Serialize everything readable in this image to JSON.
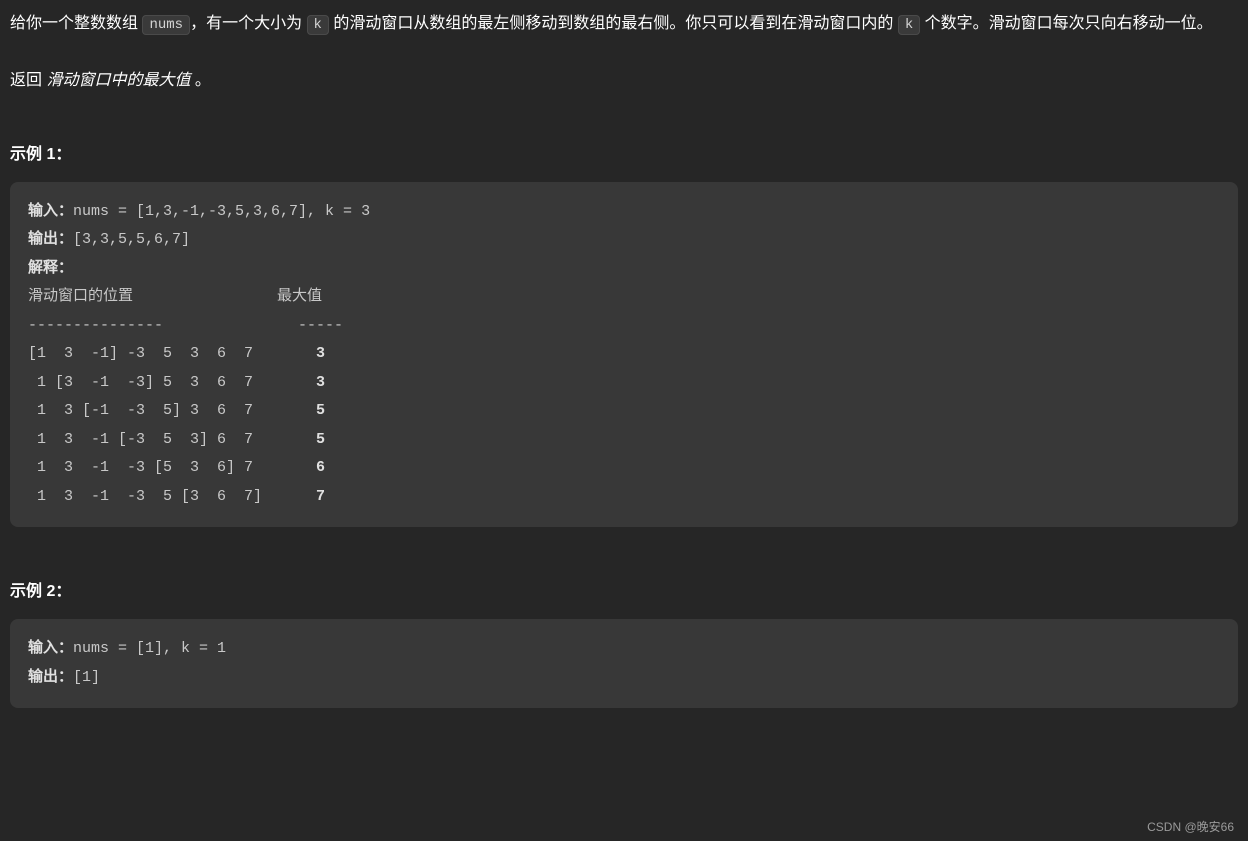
{
  "description": {
    "prefix1": "给你一个整数数组 ",
    "code1": "nums",
    "mid1": "，有一个大小为 ",
    "code2": "k",
    "mid2": " 的滑动窗口从数组的最左侧移动到数组的最右侧。你只可以看到在滑动窗口内的 ",
    "code3": "k",
    "suffix": " 个数字。滑动窗口每次只向右移动一位。"
  },
  "return_line": {
    "prefix": "返回 ",
    "italic": "滑动窗口中的最大值 ",
    "suffix": "。"
  },
  "example1": {
    "title": "示例 1：",
    "input_label": "输入：",
    "input_value": "nums = [1,3,-1,-3,5,3,6,7], k = 3",
    "output_label": "输出：",
    "output_value": "[3,3,5,5,6,7]",
    "explain_label": "解释：",
    "header_line": "滑动窗口的位置                最大值",
    "divider_line": "---------------               -----",
    "rows": [
      {
        "window": "[1  3  -1] -3  5  3  6  7       ",
        "max": "3"
      },
      {
        "window": " 1 [3  -1  -3] 5  3  6  7       ",
        "max": "3"
      },
      {
        "window": " 1  3 [-1  -3  5] 3  6  7       ",
        "max": "5"
      },
      {
        "window": " 1  3  -1 [-3  5  3] 6  7       ",
        "max": "5"
      },
      {
        "window": " 1  3  -1  -3 [5  3  6] 7       ",
        "max": "6"
      },
      {
        "window": " 1  3  -1  -3  5 [3  6  7]      ",
        "max": "7"
      }
    ]
  },
  "example2": {
    "title": "示例 2：",
    "input_label": "输入：",
    "input_value": "nums = [1], k = 1",
    "output_label": "输出：",
    "output_value": "[1]"
  },
  "watermark": "CSDN @晚安66"
}
